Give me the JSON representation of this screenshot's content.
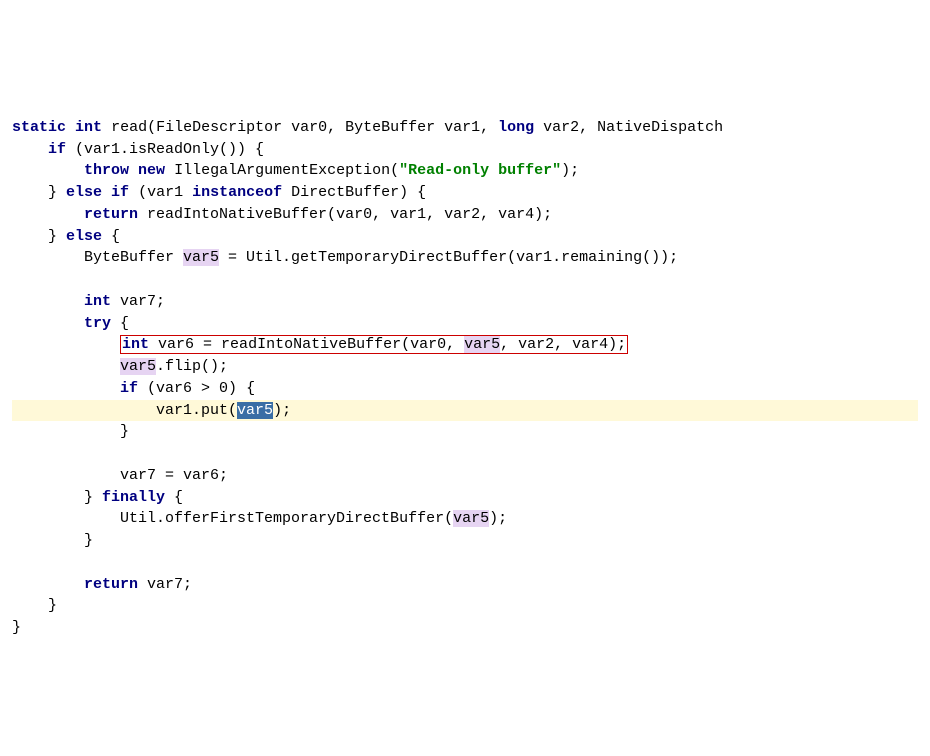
{
  "code": {
    "kw_static": "static",
    "kw_int1": "int",
    "fn_read": "read(FileDescriptor var0, ByteBuffer var1, ",
    "kw_long": "long",
    "sig_tail": " var2, NativeDispatch",
    "l2a": "    ",
    "kw_if1": "if",
    "l2b": " (var1.isReadOnly()) {",
    "l3a": "        ",
    "kw_throw": "throw",
    "kw_new": "new",
    "l3b": " IllegalArgumentException(",
    "str1": "\"Read-only buffer\"",
    "l3c": ");",
    "l4a": "    } ",
    "kw_else1": "else",
    "kw_if2": "if",
    "l4b": " (var1 ",
    "kw_instanceof": "instanceof",
    "l4c": " DirectBuffer) {",
    "l5a": "        ",
    "kw_return1": "return",
    "l5b": " readIntoNativeBuffer(var0, var1, var2, var4);",
    "l6a": "    } ",
    "kw_else2": "else",
    "l6b": " {",
    "l7a": "        ByteBuffer ",
    "var5_1": "var5",
    "l7b": " = Util.getTemporaryDirectBuffer(var1.remaining());",
    "l8": "",
    "l9a": "        ",
    "kw_int2": "int",
    "l9b": " var7;",
    "l10a": "        ",
    "kw_try": "try",
    "l10b": " {",
    "l11a": "            ",
    "kw_int3": "int",
    "l11b": " var6 = readIntoNativeBuffer(var0, ",
    "var5_2": "var5",
    "l11c": ", var2, var4);",
    "l12a": "            ",
    "var5_3": "var5",
    "l12b": ".flip();",
    "l13a": "            ",
    "kw_if3": "if",
    "l13b": " (var6 > 0) {",
    "l14a": "                var1.put(",
    "var5_sel": "var5",
    "l14b": ");",
    "l15": "            }",
    "l16": "",
    "l17": "            var7 = var6;",
    "l18a": "        } ",
    "kw_finally": "finally",
    "l18b": " {",
    "l19a": "            Util.offerFirstTemporaryDirectBuffer(",
    "var5_4": "var5",
    "l19b": ");",
    "l20": "        }",
    "l21": "",
    "l22a": "        ",
    "kw_return2": "return",
    "l22b": " var7;",
    "l23": "    }",
    "l24": "}"
  }
}
